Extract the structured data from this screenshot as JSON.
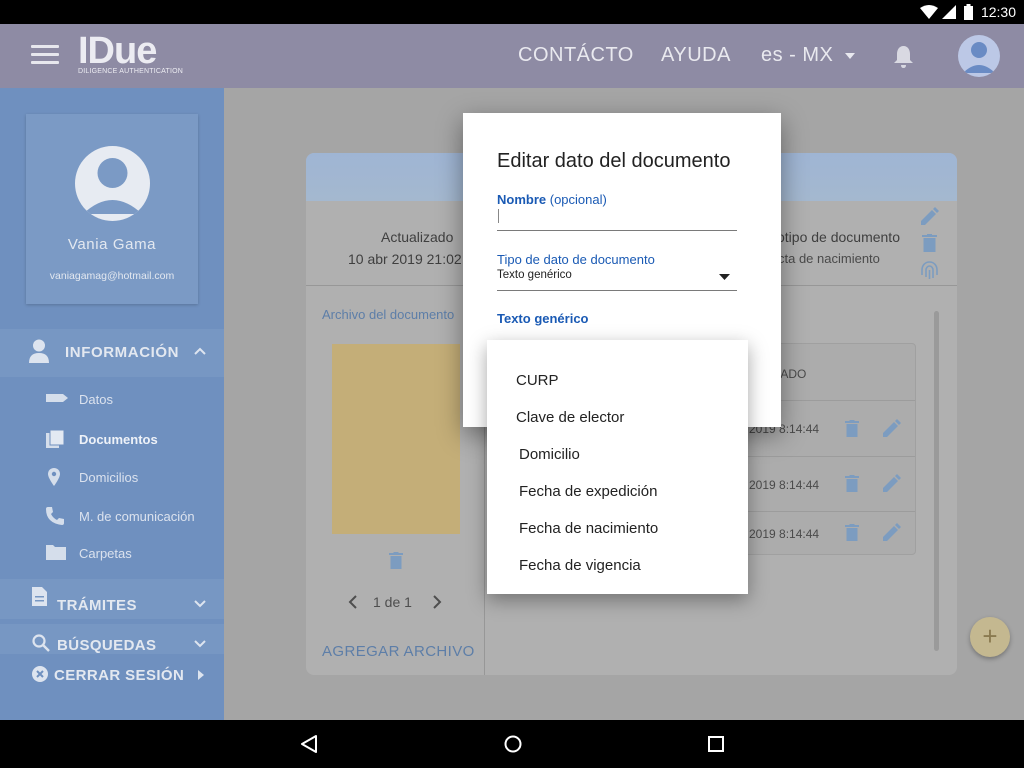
{
  "status_bar": {
    "time": "12:30"
  },
  "header": {
    "logo_main": "IDue",
    "logo_sub": "DILIGENCE AUTHENTICATION",
    "nav_contact": "CONTÁCTO",
    "nav_help": "AYUDA",
    "locale": "es - MX"
  },
  "sidebar": {
    "user_name": "Vania Gama",
    "user_email": "vaniagamag@hotmail.com",
    "section_info": "INFORMACIÓN",
    "sub_items": [
      {
        "label": "Datos"
      },
      {
        "label": "Documentos"
      },
      {
        "label": "Domicilios"
      },
      {
        "label": "M. de comunicación"
      },
      {
        "label": "Carpetas"
      }
    ],
    "section_tramites": "TRÁMITES",
    "section_busquedas": "BÚSQUEDAS",
    "section_logout": "CERRAR SESIÓN"
  },
  "main": {
    "updated_label": "Actualizado",
    "updated_value": "10 abr 2019 21:02",
    "doctype_label": "otipo de documento",
    "doctype_value": "cta de nacimiento",
    "file_section_label": "Archivo del documento",
    "pagination": "1 de 1",
    "add_file": "AGREGAR ARCHIVO",
    "table_header": "ZADO",
    "rows": [
      {
        "time": "2019 8:14:44"
      },
      {
        "time": "2019 8:14:44"
      },
      {
        "time": "2019 8:14:44"
      }
    ],
    "colors": {
      "file_placeholder": "#c4ae78",
      "accent": "#1a5ab4"
    }
  },
  "dialog": {
    "title": "Editar dato del documento",
    "name_label": "Nombre",
    "name_optional": "(opcional)",
    "name_value": "",
    "type_label": "Tipo de dato de documento",
    "type_value": "Texto genérico",
    "text_label": "Texto genérico"
  },
  "dropdown": {
    "options": [
      "CURP",
      "Clave de elector",
      "Domicilio",
      "Fecha de expedición",
      "Fecha de nacimiento",
      "Fecha de vigencia"
    ]
  }
}
